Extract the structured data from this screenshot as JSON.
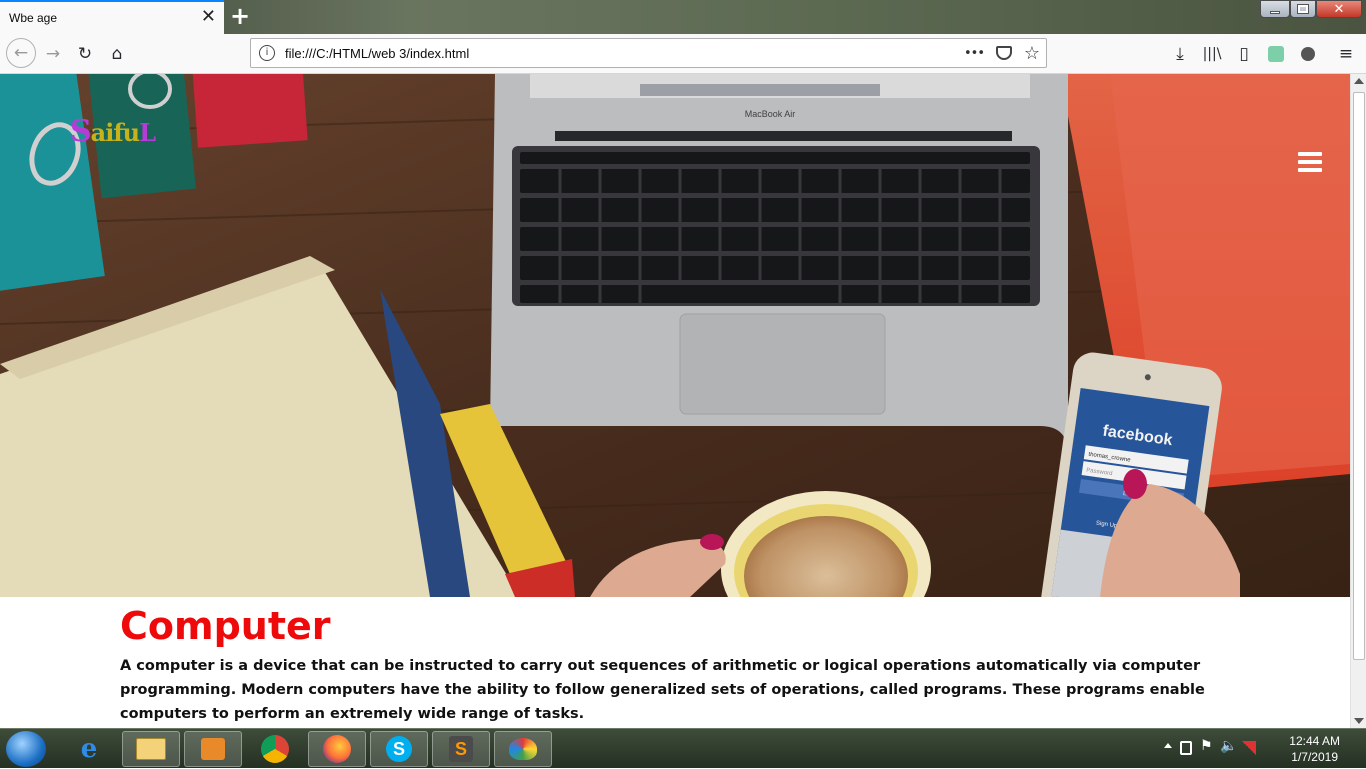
{
  "browser": {
    "tab_title": "Wbe age",
    "tab_close": "✕",
    "new_tab": "+",
    "url": "file:///C:/HTML/web 3/index.html",
    "page_actions": "•••"
  },
  "page": {
    "logo_first": "S",
    "logo_rest": "aifu",
    "logo_last": "L",
    "article_title": "Computer",
    "article_body": "A computer is a device that can be instructed to carry out sequences of arithmetic or logical operations automatically via computer programming. Modern computers have the ability to follow generalized sets of operations, called programs. These programs enable computers to perform an extremely wide range of tasks.",
    "hero_laptop_label": "MacBook Air",
    "hero_phone_brand": "facebook",
    "hero_phone_user": "thomas_crowne",
    "hero_phone_password": "Password",
    "hero_phone_login": "Log In",
    "hero_phone_signup": "Sign Up for Facebook"
  },
  "taskbar": {
    "clock_time": "12:44 AM",
    "clock_date": "1/7/2019",
    "apps": [
      "internet-explorer",
      "file-explorer",
      "media-player",
      "chrome",
      "firefox",
      "skype",
      "sublime-text",
      "paint"
    ]
  },
  "colors": {
    "title_red": "#ee0a0a",
    "logo_purple": "#b63cd8",
    "logo_gold": "#c8b21a",
    "accent_blue": "#0a84ff"
  }
}
